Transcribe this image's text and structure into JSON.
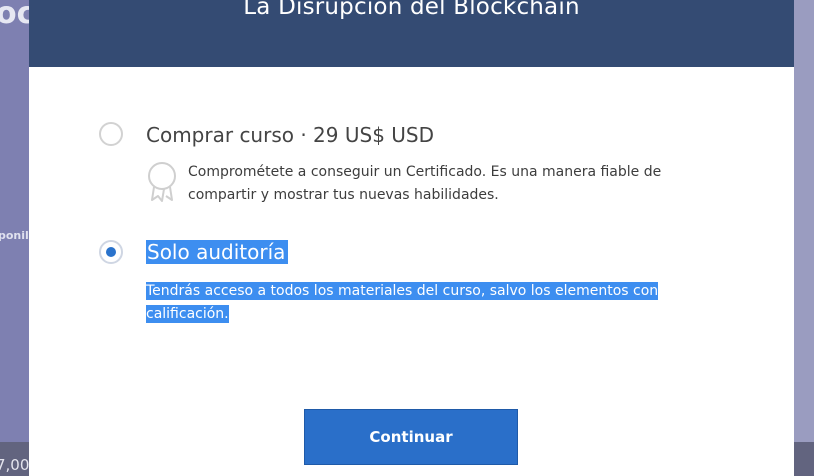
{
  "background": {
    "title_fragment": "oc",
    "side_text_fragment": "ponil",
    "bottom_text_fragment": "7,00"
  },
  "modal": {
    "title": "La Disrupción del Blockchain",
    "options": [
      {
        "label": "Comprar curso · 29 US$ USD",
        "description": "Comprométete a conseguir un Certificado. Es una manera fiable de compartir y mostrar tus nuevas habilidades.",
        "selected": false,
        "icon": "certificate-icon"
      },
      {
        "label": "Solo auditoría",
        "description": "Tendrás acceso a todos los materiales del curso, salvo los elementos con calificación.",
        "selected": true
      }
    ],
    "continue_label": "Continuar"
  },
  "colors": {
    "header": "#344b73",
    "accent": "#2a6fc9",
    "selection_highlight": "#3d8ef0",
    "overlay": "#7e80b1"
  }
}
